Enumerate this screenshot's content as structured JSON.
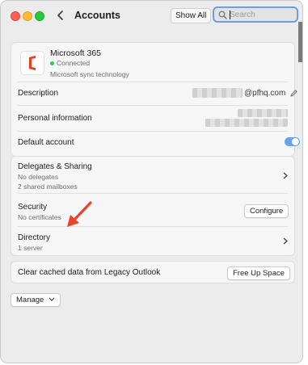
{
  "window": {
    "title": "Accounts",
    "show_all_label": "Show All",
    "search_placeholder": "Search"
  },
  "account": {
    "name": "Microsoft 365",
    "status": "Connected",
    "description": "Microsoft sync technology",
    "logo_icon": "office-logo-icon",
    "status_color": "#34c759"
  },
  "details": {
    "description_label": "Description",
    "email_visible_suffix": "@pfhq.com",
    "personal_info_label": "Personal information",
    "default_account_label": "Default account",
    "default_account_enabled": true
  },
  "delegates": {
    "label": "Delegates & Sharing",
    "line1": "No delegates",
    "line2": "2 shared mailboxes"
  },
  "security": {
    "label": "Security",
    "sub": "No certificates",
    "button": "Configure"
  },
  "directory": {
    "label": "Directory",
    "sub": "1 server"
  },
  "cache": {
    "label": "Clear cached data from Legacy Outlook",
    "button": "Free Up Space"
  },
  "manage": {
    "label": "Manage"
  },
  "colors": {
    "accent": "#63a4ea",
    "annotation_arrow": "#f0422b"
  }
}
